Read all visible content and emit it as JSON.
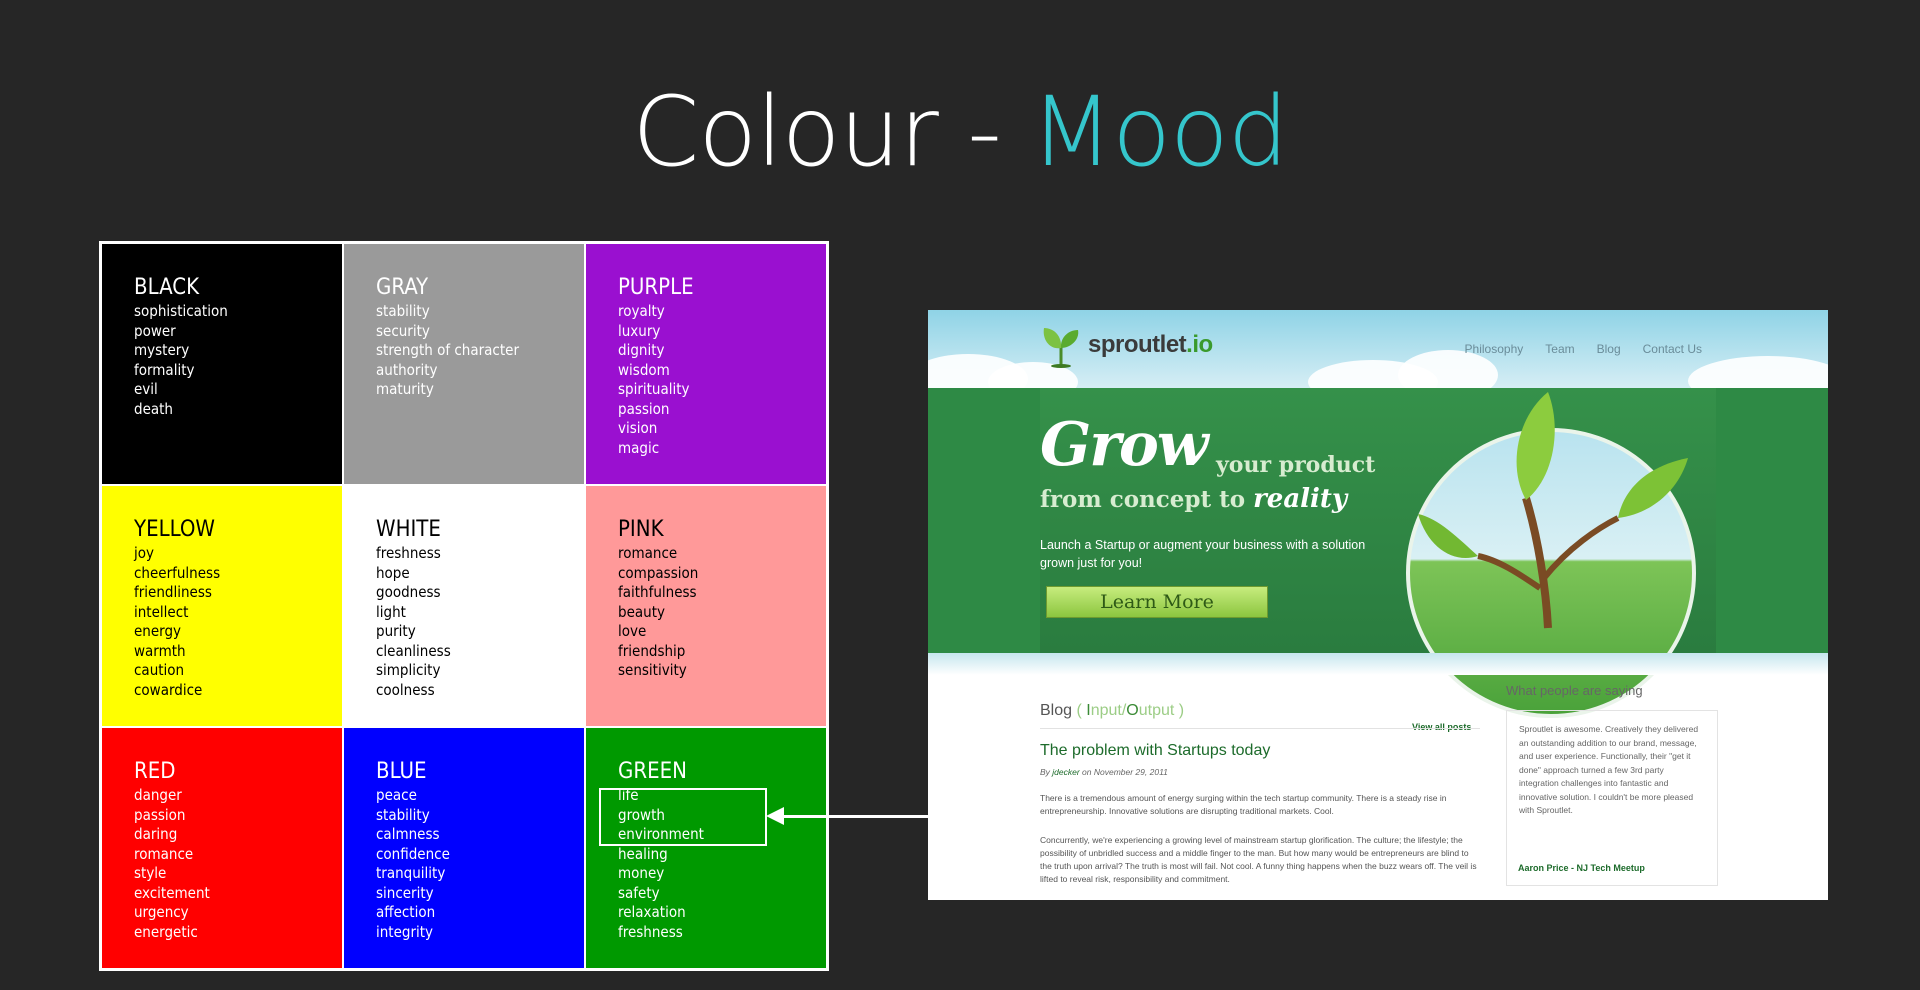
{
  "title": {
    "prefix": "Colour - ",
    "accent": "Mood",
    "accent_color": "#35c6cc"
  },
  "grid": [
    {
      "name": "BLACK",
      "bg": "#000000",
      "fg": "#ffffff",
      "words": [
        "sophistication",
        "power",
        "mystery",
        "formality",
        "evil",
        "death"
      ]
    },
    {
      "name": "GRAY",
      "bg": "#9a9a9a",
      "fg": "#ffffff",
      "words": [
        "stability",
        "security",
        "strength of character",
        "authority",
        "maturity"
      ]
    },
    {
      "name": "PURPLE",
      "bg": "#9a10d0",
      "fg": "#ffffff",
      "words": [
        "royalty",
        "luxury",
        "dignity",
        "wisdom",
        "spirituality",
        "passion",
        "vision",
        "magic"
      ]
    },
    {
      "name": "YELLOW",
      "bg": "#ffff00",
      "fg": "#000000",
      "words": [
        "joy",
        "cheerfulness",
        "friendliness",
        "intellect",
        "energy",
        "warmth",
        "caution",
        "cowardice"
      ]
    },
    {
      "name": "WHITE",
      "bg": "#ffffff",
      "fg": "#000000",
      "words": [
        "freshness",
        "hope",
        "goodness",
        "light",
        "purity",
        "cleanliness",
        "simplicity",
        "coolness"
      ]
    },
    {
      "name": "PINK",
      "bg": "#ff9999",
      "fg": "#000000",
      "words": [
        "romance",
        "compassion",
        "faithfulness",
        "beauty",
        "love",
        "friendship",
        "sensitivity"
      ]
    },
    {
      "name": "RED",
      "bg": "#ff0000",
      "fg": "#ffffff",
      "words": [
        "danger",
        "passion",
        "daring",
        "romance",
        "style",
        "excitement",
        "urgency",
        "energetic"
      ]
    },
    {
      "name": "BLUE",
      "bg": "#0000ff",
      "fg": "#ffffff",
      "words": [
        "peace",
        "stability",
        "calmness",
        "confidence",
        "tranquility",
        "sincerity",
        "affection",
        "integrity"
      ]
    },
    {
      "name": "GREEN",
      "bg": "#009900",
      "fg": "#ffffff",
      "words": [
        "life",
        "growth",
        "environment",
        "healing",
        "money",
        "safety",
        "relaxation",
        "freshness"
      ]
    }
  ],
  "site": {
    "logo": {
      "name": "sproutlet",
      "tld": ".io"
    },
    "nav": [
      "Philosophy",
      "Team",
      "Blog",
      "Contact Us"
    ],
    "hero": {
      "grow": "Grow",
      "your_product": "your product",
      "from_concept": "from concept to ",
      "reality": "reality",
      "description": "Launch a Startup or augment your business with a solution grown just for you!",
      "button": "Learn More"
    },
    "blog": {
      "heading": "Blog",
      "open": " ( ",
      "i": "I",
      "nput": "nput/",
      "o": "O",
      "utput": "utput",
      "close": " )",
      "view_all": "View all posts",
      "post_title": "The problem with Startups today",
      "by": "By ",
      "author": "jdecker",
      "date": " on November 29, 2011",
      "p1": "There is a tremendous amount of energy surging within the tech startup community. There is a steady rise in entrepreneurship. Innovative solutions are disrupting traditional markets. Cool.",
      "p2": "Concurrently, we're experiencing a growing level of mainstream startup glorification. The culture; the lifestyle; the possibility of unbridled success and a middle finger to the man. But how many would be entrepreneurs are blind to the truth upon arrival? The truth is most will fail. Not cool. A funny thing happens when the buzz wears off. The veil is lifted to reveal risk, responsibility and commitment."
    },
    "testimonials": {
      "heading": "What people are saying",
      "quote": "Sproutlet is awesome. Creatively they delivered an outstanding addition to our brand, message, and user experience. Functionally, their \"get it done\" approach turned a few 3rd party integration challenges into fantastic and innovative solution. I couldn't be more pleased with Sproutlet.",
      "author": "Aaron Price - NJ Tech Meetup"
    }
  }
}
